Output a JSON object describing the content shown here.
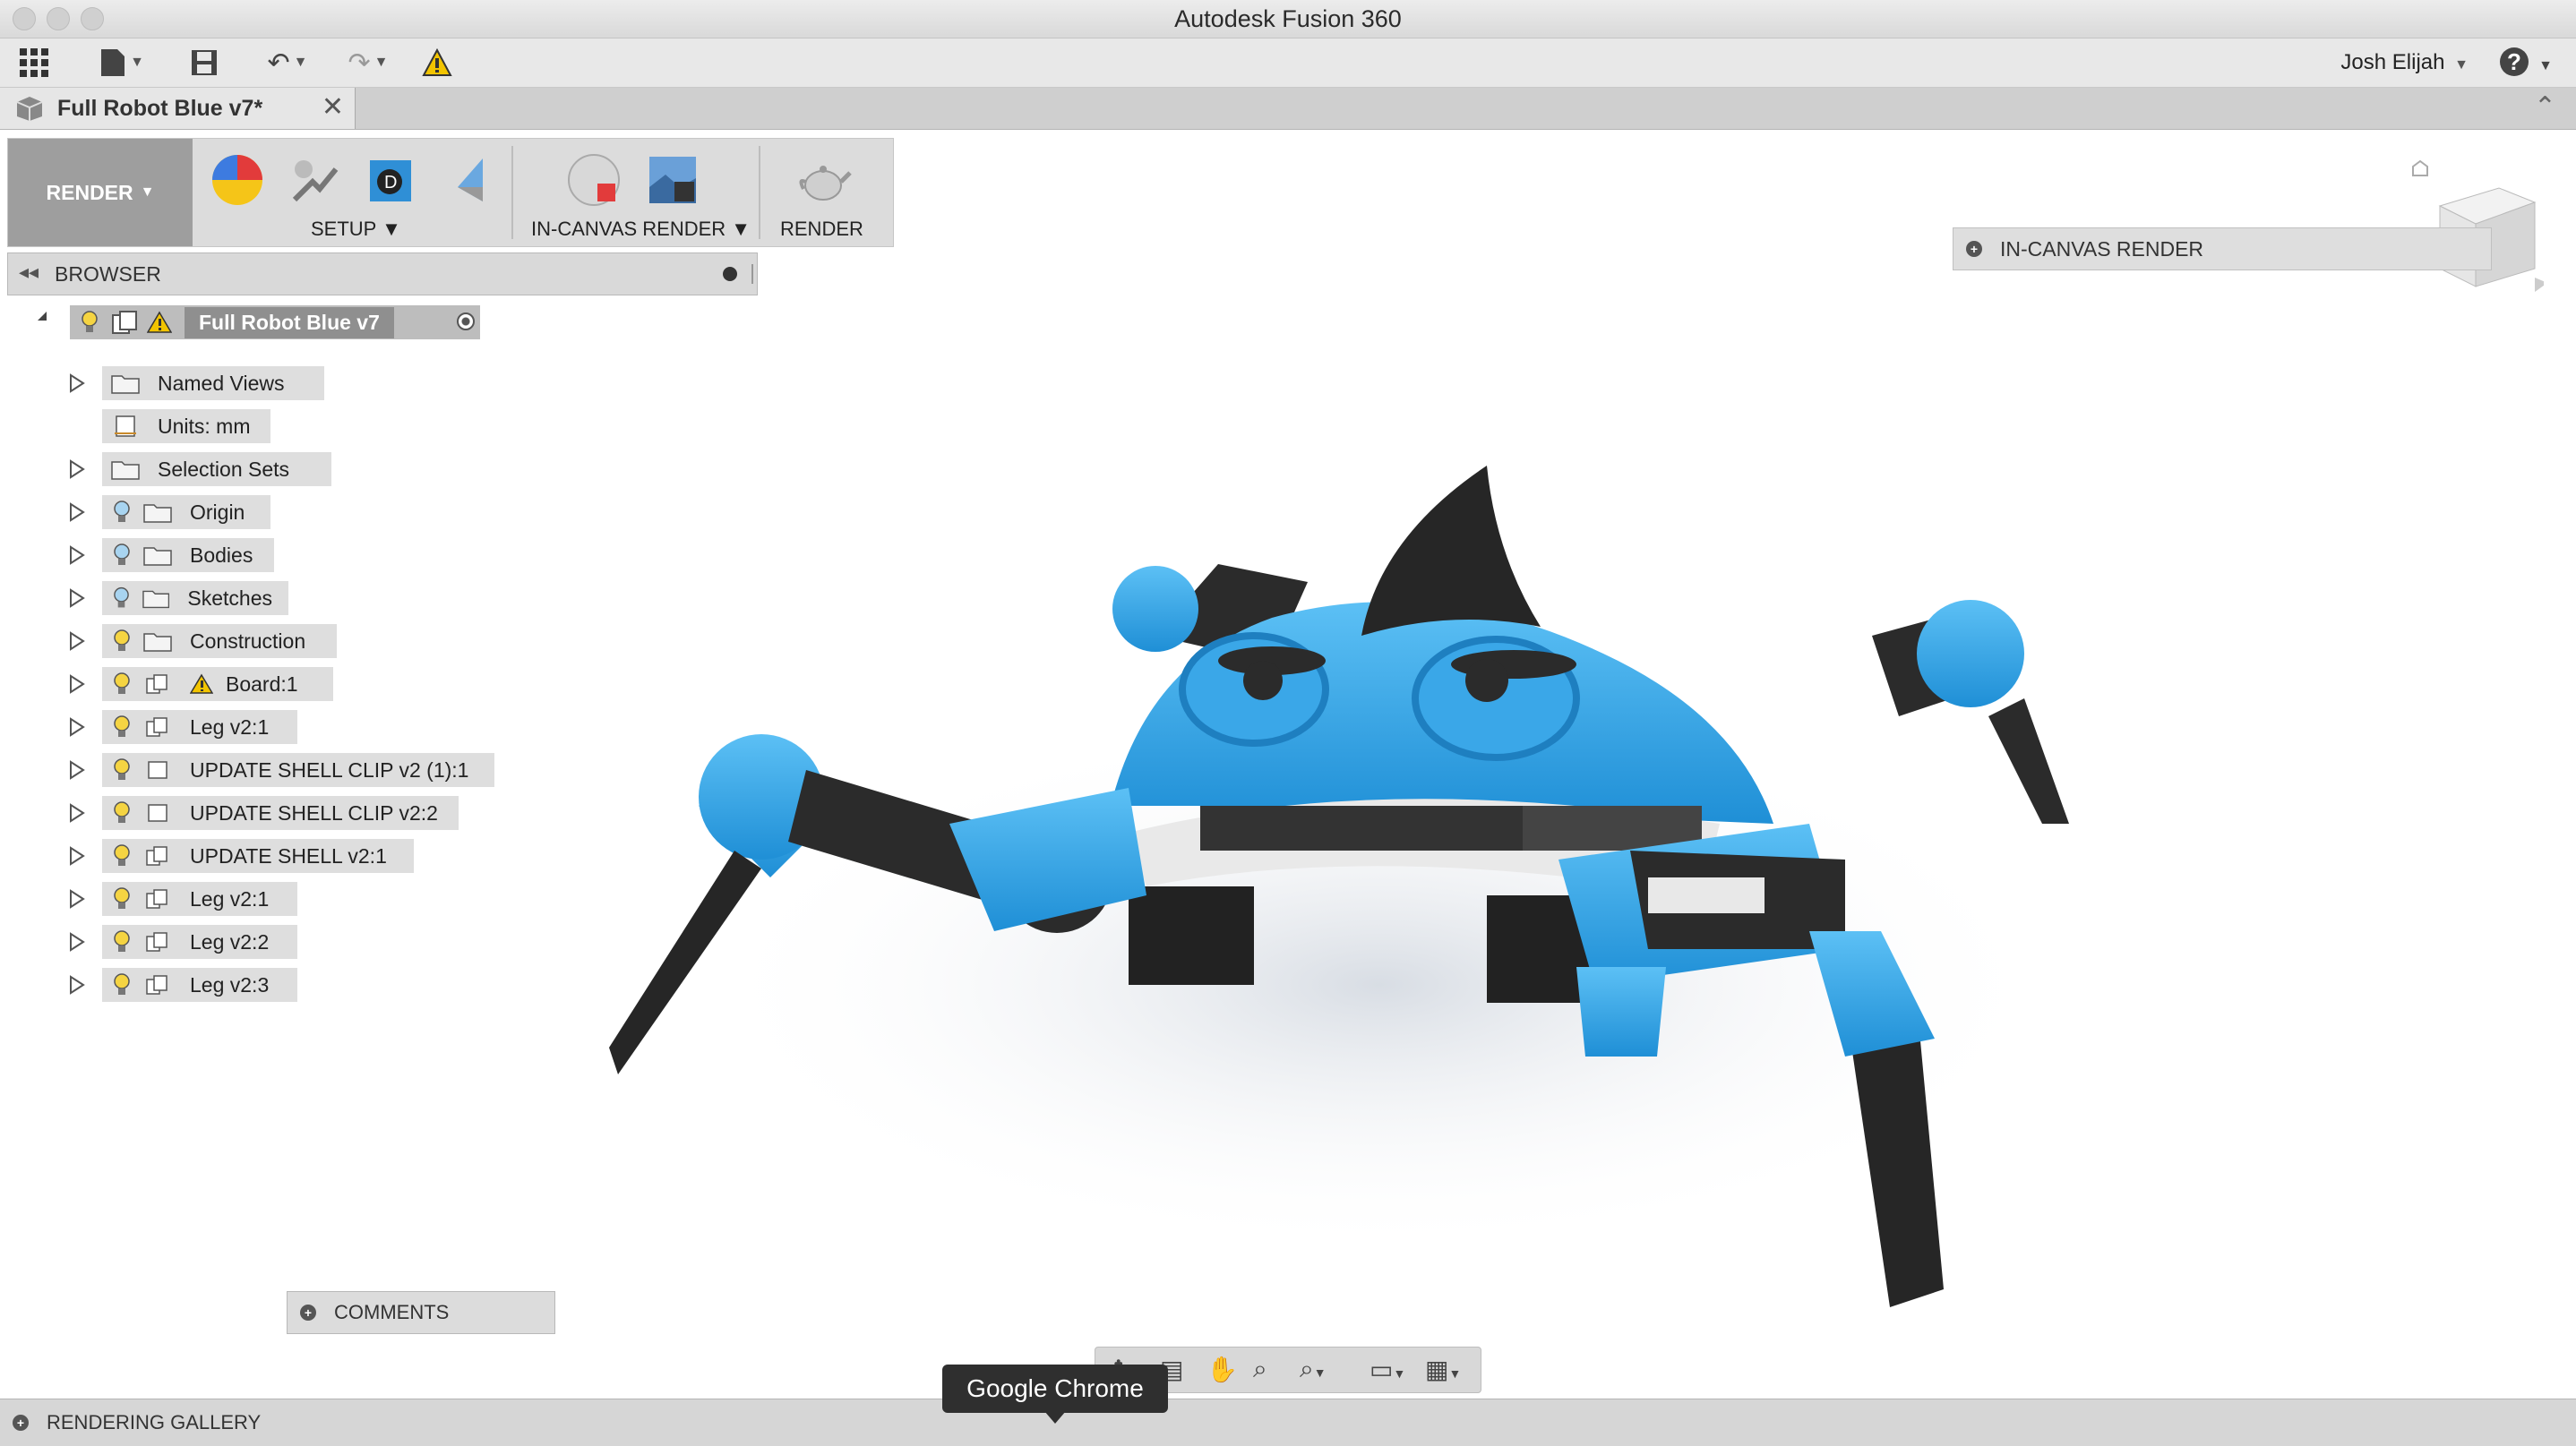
{
  "window": {
    "title": "Autodesk Fusion 360"
  },
  "quick_access": {
    "user_name": "Josh Elijah",
    "help_symbol": "?"
  },
  "document_tab": {
    "label": "Full Robot Blue v7*",
    "close": "✕"
  },
  "toolbar": {
    "workspace_label": "RENDER",
    "groups": {
      "setup": "SETUP",
      "in_canvas_render": "IN-CANVAS RENDER",
      "render": "RENDER"
    }
  },
  "browser": {
    "title": "BROWSER",
    "root": "Full Robot Blue v7",
    "items": [
      {
        "label": "Named Views"
      },
      {
        "label": "Units: mm"
      },
      {
        "label": "Selection Sets"
      },
      {
        "label": "Origin"
      },
      {
        "label": "Bodies"
      },
      {
        "label": "Sketches"
      },
      {
        "label": "Construction"
      },
      {
        "label": "Board:1"
      },
      {
        "label": "Leg v2:1"
      },
      {
        "label": "UPDATE SHELL CLIP v2 (1):1"
      },
      {
        "label": "UPDATE SHELL CLIP v2:2"
      },
      {
        "label": "UPDATE SHELL v2:1"
      },
      {
        "label": "Leg v2:1"
      },
      {
        "label": "Leg v2:2"
      },
      {
        "label": "Leg v2:3"
      }
    ]
  },
  "panels": {
    "in_canvas_render": "IN-CANVAS RENDER",
    "comments": "COMMENTS",
    "rendering_gallery": "RENDERING GALLERY"
  },
  "tooltip": {
    "text": "Google Chrome"
  },
  "colors": {
    "robot_blue": "#2ba3e6",
    "robot_dark": "#2b2b2b",
    "warning": "#f2c400"
  }
}
